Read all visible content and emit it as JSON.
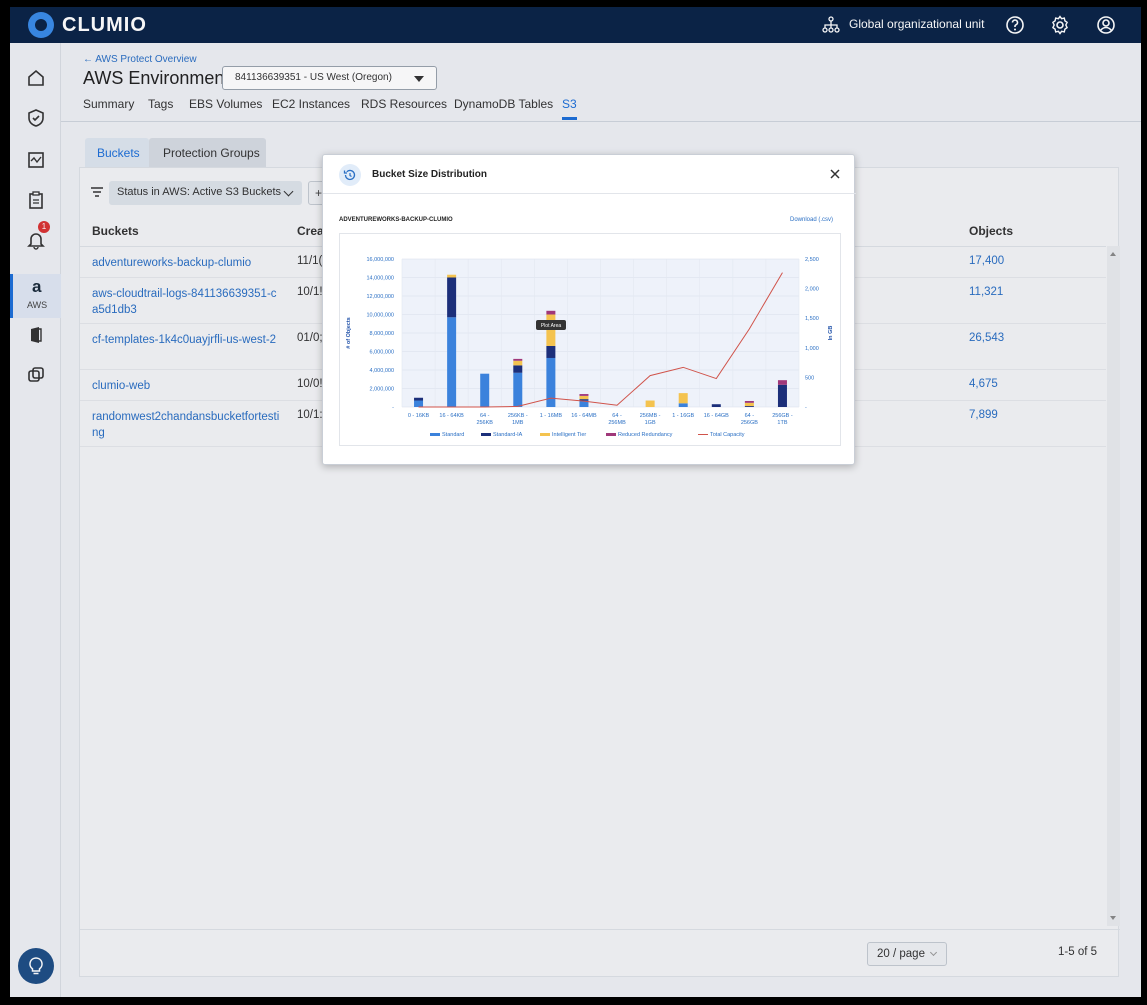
{
  "app": {
    "logo": "CLUMIO",
    "org_unit": "Global organizational unit"
  },
  "sidebar": {
    "aws_label": "AWS",
    "alert_count": "1"
  },
  "header": {
    "back_link": "← AWS Protect Overview",
    "env_title": "AWS Environment:",
    "env_value": "841136639351 - US West (Oregon)"
  },
  "tabs": [
    "Summary",
    "Tags",
    "EBS Volumes",
    "EC2 Instances",
    "RDS Resources",
    "DynamoDB Tables",
    "S3"
  ],
  "subtabs": {
    "buckets": "Buckets",
    "protection_groups": "Protection Groups"
  },
  "filter": {
    "label": "Status in AWS: Active S3 Buckets",
    "add": "+"
  },
  "table": {
    "columns": {
      "buckets": "Buckets",
      "created": "Creat",
      "objects": "Objects"
    },
    "rows": [
      {
        "name": "adventureworks-backup-clumio",
        "created": "11/1(",
        "objects": "17,400"
      },
      {
        "name": "aws-cloudtrail-logs-841136639351-ca5d1db3",
        "created": "10/1!",
        "objects": "11,321"
      },
      {
        "name": "cf-templates-1k4c0uayjrfli-us-west-2",
        "created": "01/0;",
        "objects": "26,543"
      },
      {
        "name": "clumio-web",
        "created": "10/0!",
        "objects": "4,675"
      },
      {
        "name": "randomwest2chandansbucketfortesting",
        "created": "10/1:",
        "objects": "7,899"
      }
    ]
  },
  "pagination": {
    "page_size": "20 / page",
    "range": "1-5 of 5"
  },
  "modal": {
    "title": "Bucket Size Distribution",
    "chart_heading": "ADVENTUREWORKS-BACKUP-CLUMIO",
    "download": "Download (.csv)",
    "tooltip": "Plot Area"
  },
  "colors": {
    "standard": "#3b82dc",
    "standard_ia": "#1c2f7a",
    "intelligent_tier": "#f4c34f",
    "reduced_redundancy": "#a0387a",
    "total_capacity": "#d0534a",
    "brand": "#0b2447",
    "accent": "#1d6fd8"
  },
  "chart_data": {
    "type": "bar",
    "title": "ADVENTUREWORKS-BACKUP-CLUMIO",
    "ylabel": "# of Objects",
    "y2label": "In GB",
    "ylim": [
      0,
      16000000
    ],
    "y2lim": [
      0,
      2500
    ],
    "yticks": [
      "-",
      "2,000,000",
      "4,000,000",
      "6,000,000",
      "8,000,000",
      "10,000,000",
      "12,000,000",
      "14,000,000",
      "16,000,000"
    ],
    "y2ticks": [
      "-",
      "500",
      "1,000",
      "1,500",
      "2,000",
      "2,500"
    ],
    "categories": [
      "0 - 16KB",
      "16 - 64KB",
      "64 - 256KB",
      "256KB - 1MB",
      "1 - 16MB",
      "16 - 64MB",
      "64 - 256MB",
      "256MB - 1GB",
      "1 - 16GB",
      "16 - 64GB",
      "64 - 256GB",
      "256GB - 1TB"
    ],
    "series": [
      {
        "name": "Standard",
        "values": [
          700000,
          9700000,
          3600000,
          3700000,
          5300000,
          700000,
          0,
          0,
          400000,
          0,
          0,
          0
        ]
      },
      {
        "name": "Standard-IA",
        "values": [
          300000,
          4300000,
          0,
          800000,
          1300000,
          150000,
          0,
          0,
          0,
          300000,
          100000,
          2400000
        ]
      },
      {
        "name": "Intelligent Tier",
        "values": [
          0,
          300000,
          0,
          500000,
          3400000,
          350000,
          0,
          700000,
          1100000,
          0,
          350000,
          0
        ]
      },
      {
        "name": "Reduced Redundancy",
        "values": [
          0,
          0,
          0,
          200000,
          400000,
          200000,
          0,
          0,
          0,
          0,
          200000,
          500000
        ]
      },
      {
        "name": "Total Capacity",
        "type": "line",
        "axis": "right",
        "values": [
          0,
          0,
          0,
          10,
          150,
          100,
          30,
          530,
          670,
          480,
          1320,
          2270
        ]
      }
    ],
    "legend": "bottom"
  }
}
